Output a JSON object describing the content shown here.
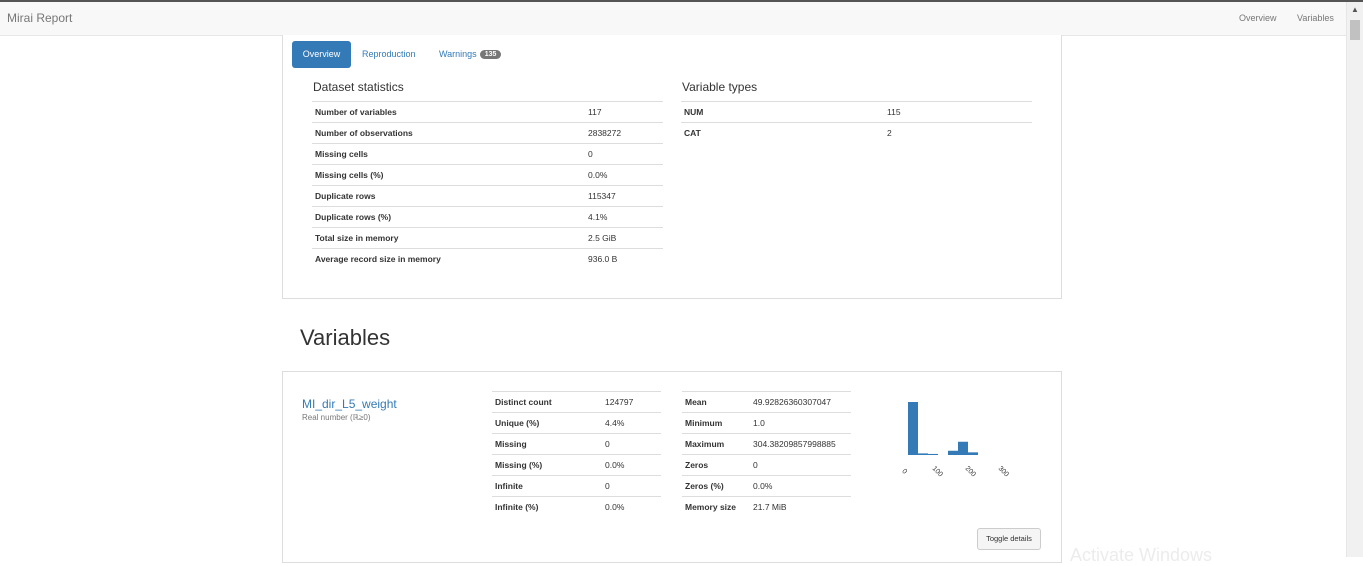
{
  "navbar": {
    "brand": "Mirai Report",
    "links": [
      "Overview",
      "Variables"
    ]
  },
  "tabs": {
    "overview": "Overview",
    "reproduction": "Reproduction",
    "warnings": "Warnings",
    "warnings_count": "135"
  },
  "dataset_statistics": {
    "title": "Dataset statistics",
    "rows": [
      {
        "label": "Number of variables",
        "value": "117"
      },
      {
        "label": "Number of observations",
        "value": "2838272"
      },
      {
        "label": "Missing cells",
        "value": "0"
      },
      {
        "label": "Missing cells (%)",
        "value": "0.0%"
      },
      {
        "label": "Duplicate rows",
        "value": "115347"
      },
      {
        "label": "Duplicate rows (%)",
        "value": "4.1%"
      },
      {
        "label": "Total size in memory",
        "value": "2.5 GiB"
      },
      {
        "label": "Average record size in memory",
        "value": "936.0 B"
      }
    ]
  },
  "variable_types": {
    "title": "Variable types",
    "rows": [
      {
        "label": "NUM",
        "value": "115"
      },
      {
        "label": "CAT",
        "value": "2"
      }
    ]
  },
  "variables_heading": "Variables",
  "variable": {
    "name": "MI_dir_L5_weight",
    "type": "Real number (ℝ≥0)",
    "left_stats": [
      {
        "label": "Distinct count",
        "value": "124797"
      },
      {
        "label": "Unique (%)",
        "value": "4.4%"
      },
      {
        "label": "Missing",
        "value": "0"
      },
      {
        "label": "Missing (%)",
        "value": "0.0%"
      },
      {
        "label": "Infinite",
        "value": "0"
      },
      {
        "label": "Infinite (%)",
        "value": "0.0%"
      }
    ],
    "right_stats": [
      {
        "label": "Mean",
        "value": "49.92826360307047"
      },
      {
        "label": "Minimum",
        "value": "1.0"
      },
      {
        "label": "Maximum",
        "value": "304.38209857998885"
      },
      {
        "label": "Zeros",
        "value": "0"
      },
      {
        "label": "Zeros (%)",
        "value": "0.0%"
      },
      {
        "label": "Memory size",
        "value": "21.7 MiB"
      }
    ],
    "toggle_label": "Toggle details",
    "histogram": {
      "xticks": [
        "0",
        "100",
        "200",
        "300"
      ],
      "color": "#337ab7",
      "bins": [
        1.0,
        0.03,
        0.02,
        0.0,
        0.08,
        0.25,
        0.05,
        0.0,
        0.0
      ]
    }
  },
  "watermark": "Activate Windows"
}
